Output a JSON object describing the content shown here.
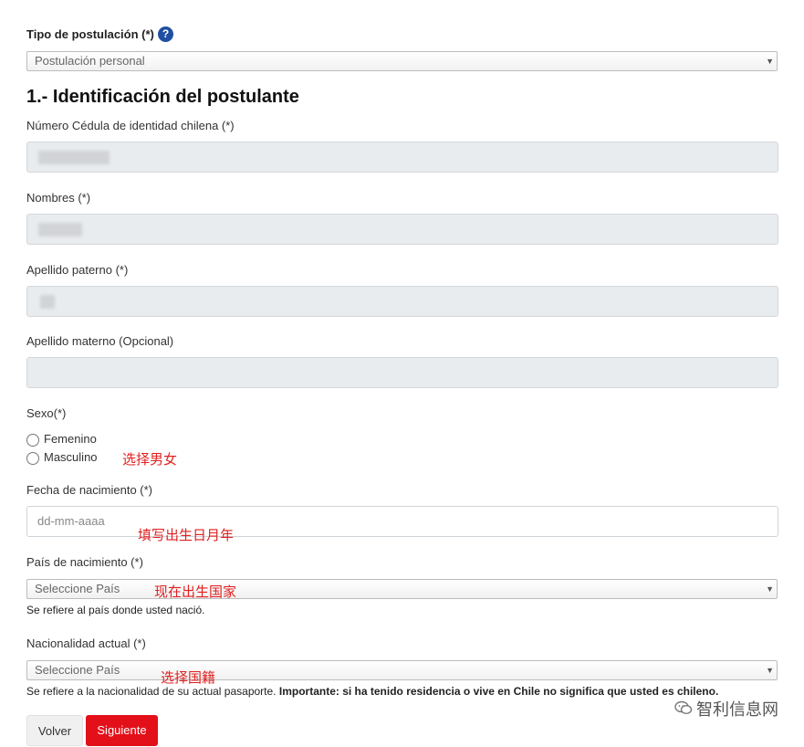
{
  "tipo": {
    "label": "Tipo de postulación (*)",
    "help": "?",
    "select_value": "Postulación personal"
  },
  "section_title": "1.- Identificación del postulante",
  "cedula": {
    "label": "Número Cédula de identidad chilena (*)"
  },
  "nombres": {
    "label": "Nombres (*)"
  },
  "apellido_paterno": {
    "label": "Apellido paterno (*)"
  },
  "apellido_materno": {
    "label": "Apellido materno (Opcional)"
  },
  "sexo": {
    "label": "Sexo(*)",
    "options": [
      "Femenino",
      "Masculino"
    ],
    "note": "选择男女"
  },
  "fecha": {
    "label": "Fecha de nacimiento (*)",
    "placeholder": "dd-mm-aaaa",
    "note": "填写出生日月年"
  },
  "pais": {
    "label": "País de nacimiento (*)",
    "select_value": "Seleccione País",
    "note": "现在出生国家",
    "hint": "Se refiere al país donde usted nació."
  },
  "nacionalidad": {
    "label": "Nacionalidad actual (*)",
    "select_value": "Seleccione País",
    "note": "选择国籍",
    "hint_regular": "Se refiere a la nacionalidad de su actual pasaporte. ",
    "hint_bold": "Importante: si ha tenido residencia o vive en Chile no significa que usted es chileno."
  },
  "buttons": {
    "back": "Volver",
    "next": "Siguiente"
  },
  "watermark": "智利信息网",
  "icons": {
    "help": "question-circle-icon",
    "dropdown": "caret-down-icon",
    "watermark": "wechat-icon"
  }
}
